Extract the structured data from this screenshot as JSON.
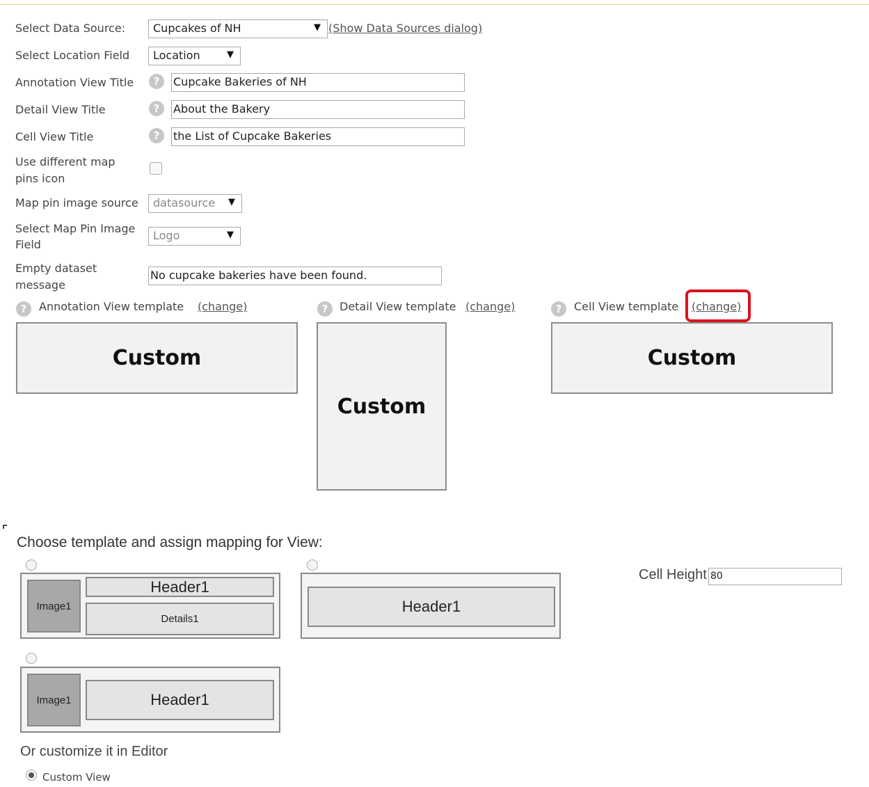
{
  "form": {
    "data_source_label": "Select Data Source:",
    "data_source_value": "Cupcakes of NH",
    "show_dialog_link": "(Show Data Sources dialog)",
    "location_label": "Select Location Field",
    "location_value": "Location",
    "annotation_title_label": "Annotation View Title",
    "annotation_title_value": "Cupcake Bakeries of NH",
    "detail_title_label": "Detail View Title",
    "detail_title_value": "About the Bakery",
    "cell_title_label": "Cell View Title",
    "cell_title_value": "the List of Cupcake Bakeries",
    "map_pins_label_1": "Use different map",
    "map_pins_label_2": "pins icon",
    "pin_source_label": "Map pin image source",
    "pin_source_value": "datasource",
    "pin_field_label_1": "Select Map Pin Image",
    "pin_field_label_2": "Field",
    "pin_field_value": "Logo",
    "empty_label_1": "Empty dataset",
    "empty_label_2": "message",
    "empty_value": "No cupcake bakeries have been found."
  },
  "templates": {
    "help_glyph": "?",
    "annotation_label": "Annotation View template",
    "detail_label": "Detail View template",
    "cell_label": "Cell View template",
    "change_link": "(change)",
    "custom_text": "Custom"
  },
  "chooser": {
    "heading": "Choose template and assign mapping for View:",
    "cell_height_label": "Cell Height",
    "cell_height_value": "80",
    "image_label": "Image1",
    "header_label": "Header1",
    "details_label": "Details1",
    "editor_label": "Or customize it in Editor",
    "custom_view_label": "Custom View"
  },
  "colors": {
    "highlight": "#d9141e"
  },
  "icons": {
    "help": "help-icon",
    "dropdown": "dropdown-arrow-icon"
  }
}
